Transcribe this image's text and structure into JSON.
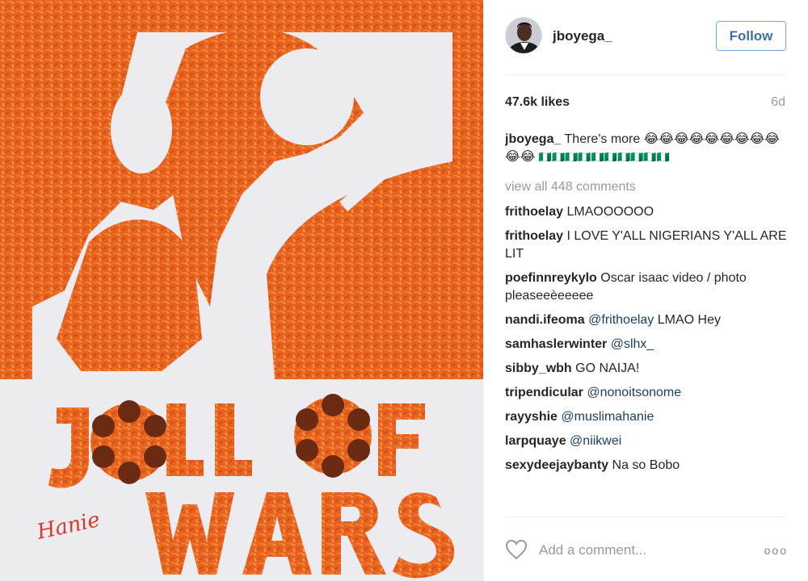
{
  "post": {
    "username": "jboyega_",
    "follow_label": "Follow",
    "likes": "47.6k likes",
    "time_ago": "6d",
    "caption_user": "jboyega_",
    "caption_text": "There's more 😂😂😂😂😂😂😂😂😂😂😂",
    "caption_rest": "🇳🇬🇳🇬🇳🇬🇳🇬🇳🇬🇳🇬🇳🇬🇳🇬🇳🇬🇳🇬",
    "view_all": "view all 448 comments"
  },
  "photo": {
    "title_line1": "JOLLOF",
    "title_line2": "WARS",
    "signature": "Hanie",
    "bg_color": "#ecebf0",
    "rice_color": "#e8621f",
    "plantain_color": "#6b2a12"
  },
  "comments": [
    {
      "user": "frithoelay",
      "text": "LMAOOOOOO",
      "mention": ""
    },
    {
      "user": "frithoelay",
      "text": "I LOVE Y'ALL NIGERIANS Y'ALL ARE LIT",
      "mention": ""
    },
    {
      "user": "poefinnreykylo",
      "text": "Oscar isaac video / photo pleaseeèeeeee",
      "mention": ""
    },
    {
      "user": "nandi.ifeoma",
      "mention": "@frithoelay",
      "text": "LMAO Hey"
    },
    {
      "user": "samhaslerwinter",
      "mention": "@slhx_",
      "text": ""
    },
    {
      "user": "sibby_wbh",
      "mention": "",
      "text": "GO NAIJA!"
    },
    {
      "user": "tripendicular",
      "mention": "@nonoitsonome",
      "text": ""
    },
    {
      "user": "rayyshie",
      "mention": "@muslimahanie",
      "text": ""
    },
    {
      "user": "larpquaye",
      "mention": "@niikwei",
      "text": ""
    },
    {
      "user": "sexydeejaybanty",
      "mention": "",
      "text": "Na so Bobo"
    }
  ],
  "comment_box": {
    "placeholder": "Add a comment...",
    "more_label": "ooo"
  }
}
